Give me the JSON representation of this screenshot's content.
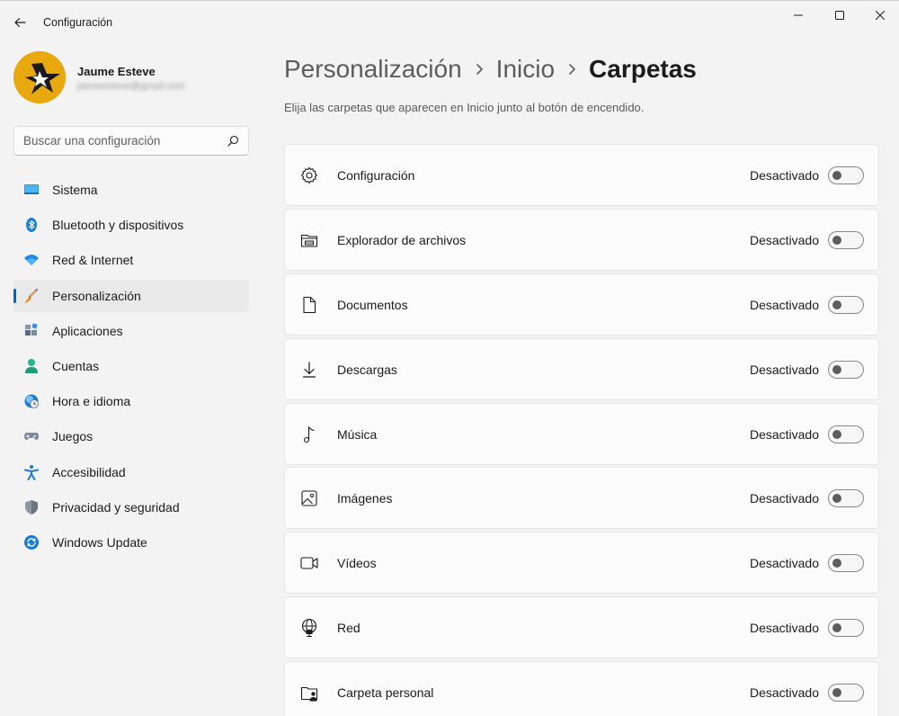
{
  "window": {
    "title": "Configuración"
  },
  "profile": {
    "name": "Jaume Esteve",
    "email": "jaimeesteve@gmail.com"
  },
  "search": {
    "placeholder": "Buscar una configuración"
  },
  "sidebar": {
    "items": [
      {
        "label": "Sistema",
        "icon": "monitor-icon"
      },
      {
        "label": "Bluetooth y dispositivos",
        "icon": "bluetooth-icon"
      },
      {
        "label": "Red & Internet",
        "icon": "wifi-icon"
      },
      {
        "label": "Personalización",
        "icon": "brush-icon",
        "active": true
      },
      {
        "label": "Aplicaciones",
        "icon": "apps-icon"
      },
      {
        "label": "Cuentas",
        "icon": "person-icon"
      },
      {
        "label": "Hora e idioma",
        "icon": "globe-clock-icon"
      },
      {
        "label": "Juegos",
        "icon": "gamepad-icon"
      },
      {
        "label": "Accesibilidad",
        "icon": "accessibility-icon"
      },
      {
        "label": "Privacidad y seguridad",
        "icon": "shield-icon"
      },
      {
        "label": "Windows Update",
        "icon": "update-icon"
      }
    ]
  },
  "breadcrumb": {
    "first": "Personalización",
    "second": "Inicio",
    "current": "Carpetas"
  },
  "subtitle": "Elija las carpetas que aparecen en Inicio junto al botón de encendido.",
  "folders": [
    {
      "label": "Configuración",
      "icon": "gear-icon",
      "state": "Desactivado",
      "on": false
    },
    {
      "label": "Explorador de archivos",
      "icon": "file-explorer-icon",
      "state": "Desactivado",
      "on": false
    },
    {
      "label": "Documentos",
      "icon": "document-icon",
      "state": "Desactivado",
      "on": false
    },
    {
      "label": "Descargas",
      "icon": "download-icon",
      "state": "Desactivado",
      "on": false
    },
    {
      "label": "Música",
      "icon": "music-icon",
      "state": "Desactivado",
      "on": false
    },
    {
      "label": "Imágenes",
      "icon": "image-icon",
      "state": "Desactivado",
      "on": false
    },
    {
      "label": "Vídeos",
      "icon": "video-icon",
      "state": "Desactivado",
      "on": false
    },
    {
      "label": "Red",
      "icon": "network-icon",
      "state": "Desactivado",
      "on": false
    },
    {
      "label": "Carpeta personal",
      "icon": "personal-folder-icon",
      "state": "Desactivado",
      "on": false
    }
  ],
  "colors": {
    "accent": "#0067c0",
    "background": "#f3f3f3",
    "card": "#fbfbfb"
  }
}
